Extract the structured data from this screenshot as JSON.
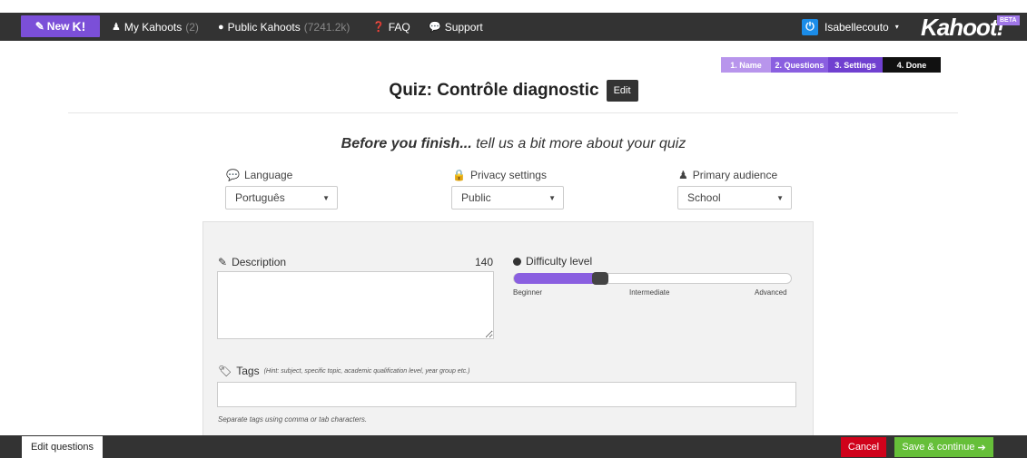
{
  "nav": {
    "new_k_label": "New",
    "new_k_mark": "K!",
    "my_kahoots_label": "My Kahoots",
    "my_kahoots_count": "(2)",
    "public_kahoots_label": "Public Kahoots",
    "public_kahoots_count": "(7241.2k)",
    "faq_label": "FAQ",
    "support_label": "Support",
    "username": "Isabellecouto",
    "logo": "Kahoot!",
    "beta": "BETA"
  },
  "steps": [
    "1. Name",
    "2. Questions",
    "3. Settings",
    "4. Done"
  ],
  "current_step": 4,
  "header": {
    "title": "Quiz: Contrôle diagnostic",
    "edit_label": "Edit"
  },
  "subtitle": {
    "bold": "Before you finish...",
    "rest": " tell us a bit more about your quiz"
  },
  "settings": {
    "language_label": "Language",
    "language_value": "Português",
    "privacy_label": "Privacy settings",
    "privacy_value": "Public",
    "audience_label": "Primary audience",
    "audience_value": "School"
  },
  "description": {
    "label": "Description",
    "remaining": "140",
    "value": ""
  },
  "difficulty": {
    "label": "Difficulty level",
    "level_fraction": 0.31,
    "ticks": [
      "Beginner",
      "Intermediate",
      "Advanced"
    ]
  },
  "tags": {
    "label": "Tags",
    "hint": "(Hint: subject, specific topic, academic qualification level, year group etc.)",
    "value": "",
    "help": "Separate tags using comma or tab characters."
  },
  "footer": {
    "edit_questions_label": "Edit questions",
    "cancel_label": "Cancel",
    "save_label": "Save & continue"
  },
  "colors": {
    "accent": "#8a5fe0",
    "cancel": "#d0021b",
    "save": "#66bf39",
    "nav_bg": "#333333"
  }
}
